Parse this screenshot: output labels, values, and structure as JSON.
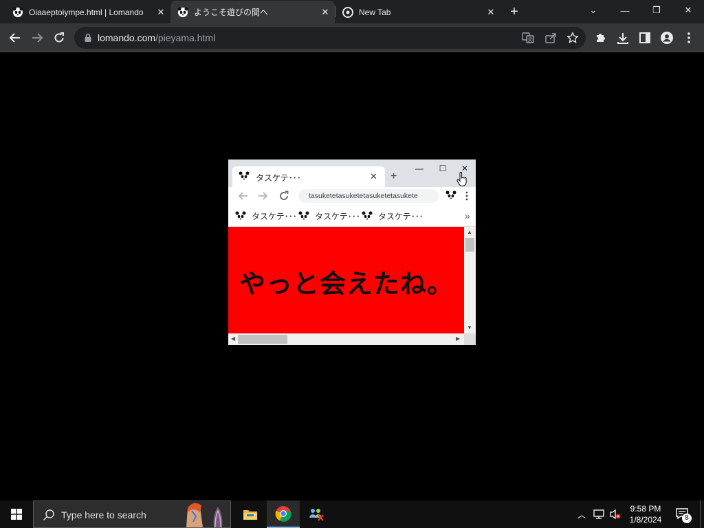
{
  "browser": {
    "tabs": [
      {
        "title": "Oiaaeptoiympe.html | Lomando",
        "favicon": "panda-icon"
      },
      {
        "title": "ようこそ遊びの間へ",
        "favicon": "panda-icon"
      },
      {
        "title": "New Tab",
        "favicon": "chrome-icon"
      }
    ],
    "active_tab": 1,
    "new_tab_label": "+",
    "window_controls": {
      "tab_search": "⌄",
      "minimize": "—",
      "restore": "❐",
      "close": "✕"
    },
    "address": {
      "domain": "lomando.com",
      "path": "/pieyama.html"
    }
  },
  "mini_browser": {
    "tab_title": "タスケテ･･･",
    "address_text": "tasuketetasuketetasuketetasukete",
    "bookmarks": [
      "タスケテ･･･",
      "タスケテ･･･",
      "タスケテ･･･"
    ],
    "bookmarks_overflow": "»",
    "message": "やっと会えたね。",
    "content_bg": "#ff0000"
  },
  "taskbar": {
    "search_placeholder": "Type here to search",
    "time": "9:58 PM",
    "date": "1/8/2024",
    "notification_count": "8"
  }
}
